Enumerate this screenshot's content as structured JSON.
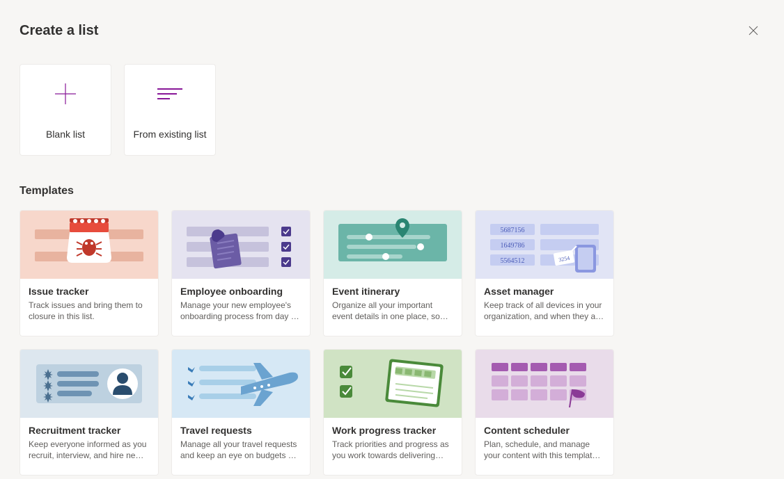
{
  "header": {
    "title": "Create a list"
  },
  "options": {
    "blank": "Blank list",
    "existing": "From existing list"
  },
  "section": {
    "templates": "Templates"
  },
  "templates": [
    {
      "title": "Issue tracker",
      "desc": "Track issues and bring them to closure in this list."
    },
    {
      "title": "Employee onboarding",
      "desc": "Manage your new employee's onboarding process from day …"
    },
    {
      "title": "Event itinerary",
      "desc": "Organize all your important event details in one place, so…"
    },
    {
      "title": "Asset manager",
      "desc": "Keep track of all devices in your organization, and when they a…"
    },
    {
      "title": "Recruitment tracker",
      "desc": "Keep everyone informed as you recruit, interview, and hire ne…"
    },
    {
      "title": "Travel requests",
      "desc": "Manage all your travel requests and keep an eye on budgets …"
    },
    {
      "title": "Work progress tracker",
      "desc": "Track priorities and progress as you work towards delivering…"
    },
    {
      "title": "Content scheduler",
      "desc": "Plan, schedule, and manage your content with this templat…"
    }
  ],
  "assetNumbers": {
    "n1": "5687156",
    "n2": "1649786",
    "n3": "5564512",
    "tag": "3254"
  }
}
